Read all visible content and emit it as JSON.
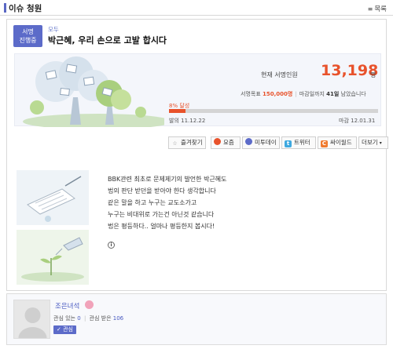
{
  "header": {
    "title": "이슈 청원",
    "more_label": "목록",
    "more_icon": "list-icon"
  },
  "petition": {
    "badge_line1": "서명",
    "badge_line2": "진행중",
    "category": "모두",
    "title": "박근혜, 우리 손으로 고발 합시다"
  },
  "stats": {
    "signers_label": "현재 서명인원",
    "signers_count": "13,198",
    "signers_unit": "명",
    "target_label": "서명목표",
    "target_value": "150,000명",
    "deadline_prefix": "마감일까지",
    "deadline_days": "41일",
    "deadline_suffix": "남았습니다",
    "progress_label": "8% 달성",
    "progress_percent": 8,
    "start_label": "발의",
    "start_date": "11.12.22",
    "end_label": "마감",
    "end_date": "12.01.31"
  },
  "share": {
    "favorite": "즐겨찾기",
    "yozm": "요즘",
    "me2day": "미투데이",
    "twitter": "트위터",
    "cyworld": "싸이월드",
    "more": "더보기"
  },
  "body": {
    "lines": [
      "BBK관련 최초로 문제제기의 발언한 박근혜도",
      "법의 판단 받던을 받아야 한다 생각합니다",
      "같은 말을 하고 누구는 교도소가고",
      "누구는 비대위로 가는건 아닌것 같습니다",
      "법은 평등하다.. 얼마나 평등한지 봅시다!"
    ]
  },
  "author": {
    "name": "조은녀석",
    "interests_label": "관심 있는",
    "interests_count": "0",
    "interested_label": "관심 받은",
    "interested_count": "106",
    "follow_label": "관심"
  },
  "colors": {
    "accent": "#5c6bc9",
    "highlight": "#e8522b"
  }
}
